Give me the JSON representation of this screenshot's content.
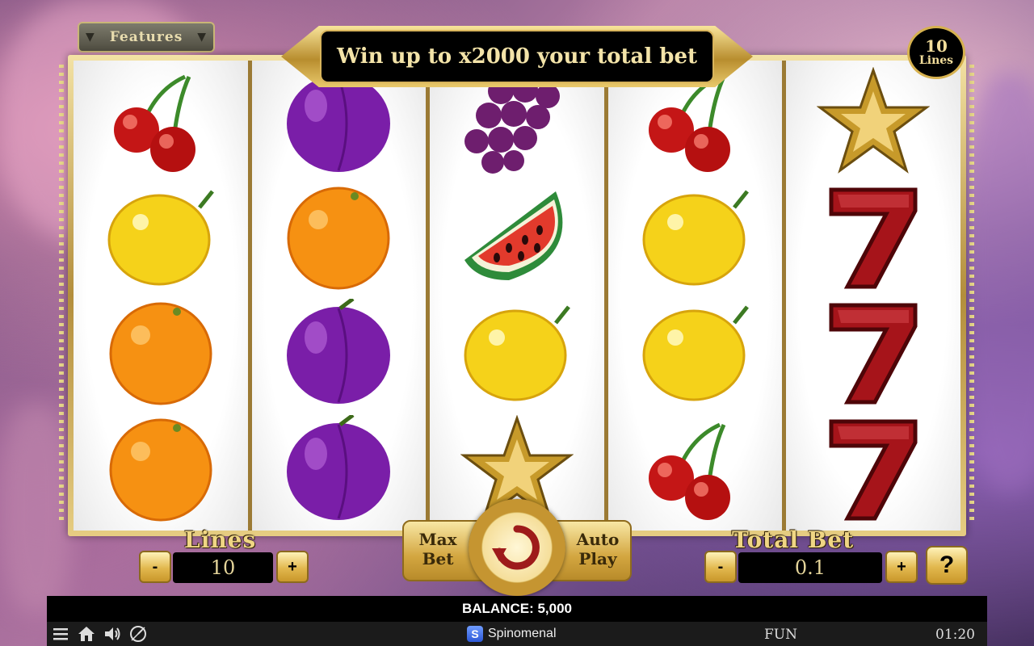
{
  "top": {
    "features_label": "Features",
    "win_banner": "Win up to x2000 your total bet",
    "lines_badge_number": "10",
    "lines_badge_text": "Lines"
  },
  "reels": [
    [
      "cherry",
      "lemon",
      "orange",
      "orange"
    ],
    [
      "plum",
      "orange",
      "plum",
      "plum"
    ],
    [
      "grapes",
      "watermelon",
      "lemon",
      "star"
    ],
    [
      "cherry",
      "lemon",
      "lemon",
      "cherry"
    ],
    [
      "star",
      "seven",
      "seven",
      "seven"
    ]
  ],
  "controls": {
    "lines_label": "Lines",
    "lines_value": "10",
    "total_bet_label": "Total Bet",
    "total_bet_value": "0.1",
    "minus": "-",
    "plus": "+",
    "max_bet": "Max Bet",
    "auto_play": "Auto Play",
    "help": "?"
  },
  "status": {
    "balance": "BALANCE: 5,000",
    "brand": "Spinomenal",
    "mode": "FUN",
    "clock": "01:20"
  },
  "icons": [
    "menu-icon",
    "home-icon",
    "sound-icon",
    "speed-icon",
    "spin-arrow-icon"
  ],
  "colors": {
    "gold": "#d6b14f",
    "frame_dark": "#9b7a34",
    "bar": "#000000"
  }
}
